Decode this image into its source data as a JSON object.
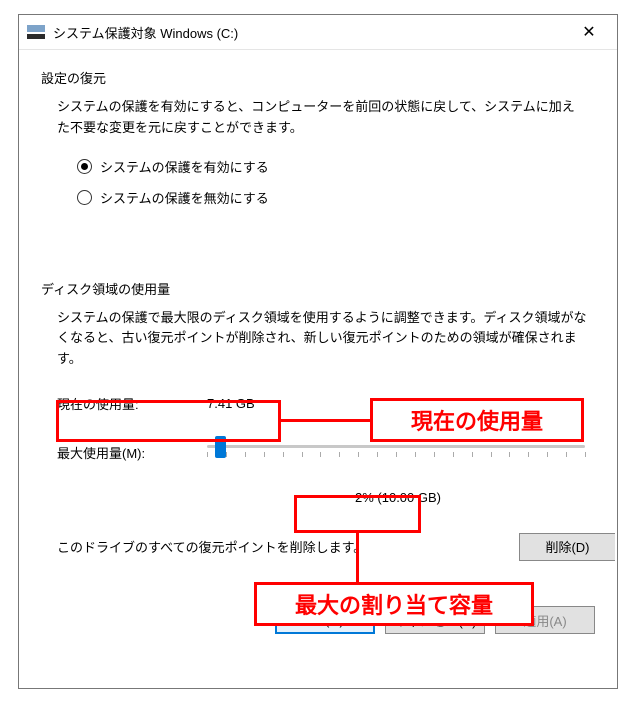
{
  "window": {
    "title": "システム保護対象 Windows (C:)",
    "close_glyph": "✕"
  },
  "restore": {
    "header": "設定の復元",
    "desc": "システムの保護を有効にすると、コンピューターを前回の状態に戻して、システムに加えた不要な変更を元に戻すことができます。",
    "opt_on": "システムの保護を有効にする",
    "opt_off": "システムの保護を無効にする",
    "selected": "on"
  },
  "disk": {
    "header": "ディスク領域の使用量",
    "desc": "システムの保護で最大限のディスク領域を使用するように調整できます。ディスク領域がなくなると、古い復元ポイントが削除され、新しい復元ポイントのための領域が確保されます。",
    "current_label": "現在の使用量:",
    "current_value": "7.41 GB",
    "max_label": "最大使用量(M):",
    "slider_value_text": "2% (10.00 GB)",
    "slider_percent": 2,
    "delete_text": "このドライブのすべての復元ポイントを削除します。",
    "delete_btn": "削除(D)"
  },
  "buttons": {
    "ok": "OK(O)",
    "cancel": "キャンセル(C)",
    "apply": "適用(A)"
  },
  "annotations": {
    "current_callout": "現在の使用量",
    "max_callout": "最大の割り当て容量"
  }
}
